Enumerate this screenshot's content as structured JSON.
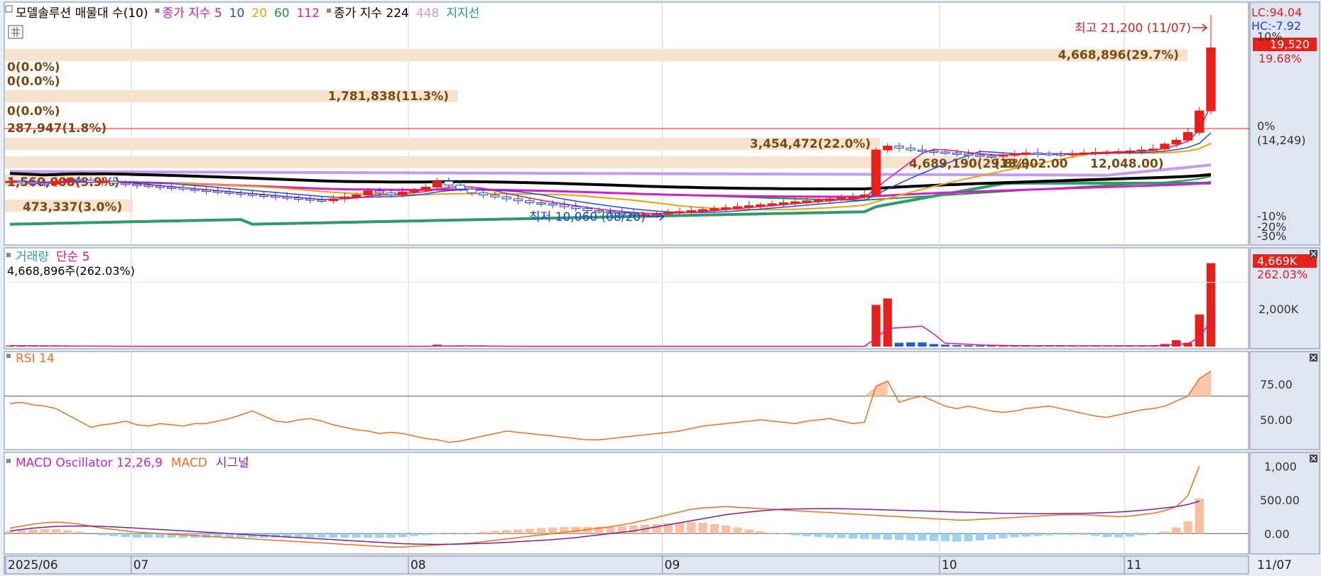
{
  "main": {
    "legend": [
      {
        "text": "모델솔루션 매물대 수(10)",
        "color": "#000000"
      },
      {
        "text": "종가 지수 5",
        "color": "#e0148c"
      },
      {
        "text": "10",
        "color": "#1f4fd6"
      },
      {
        "text": "20",
        "color": "#f0a010"
      },
      {
        "text": "60",
        "color": "#1f9a3a"
      },
      {
        "text": "112",
        "color": "#d020c8"
      },
      {
        "text": "종가 지수 224",
        "color": "#000000"
      },
      {
        "text": "448",
        "color": "#c39bf0"
      },
      {
        "text": "지지선",
        "color": "#1f9a6a"
      }
    ],
    "right_top": {
      "lc": "LC:94.04",
      "hc": "HC:-7.92"
    },
    "price_tag": "19,520",
    "price_change": "19.68%",
    "high_label": "최고 21,200 (11/07)",
    "low_label": "최저 10,060 (08/20)",
    "pct_axis": [
      "10%",
      "0%",
      "(14,249)",
      "-10%",
      "-20%",
      "-30%"
    ],
    "volume_profile": [
      {
        "label": "4,668,896(29.7%)"
      },
      {
        "label": "0(0.0%)"
      },
      {
        "label": "0(0.0%)"
      },
      {
        "label": "1,781,838(11.3%)"
      },
      {
        "label": "0(0.0%)"
      },
      {
        "label": "287,947(1.8%)"
      },
      {
        "label": "3,454,472(22.0%)"
      },
      {
        "label": "4,689,190(29.8%)"
      },
      {
        "label": "1,560,000(9.9%)"
      },
      {
        "label": "473,337(3.0%)"
      }
    ],
    "tail_labels": [
      "(13,902.00",
      "12,048.00)"
    ]
  },
  "volume": {
    "legend": [
      {
        "text": "거래량",
        "color": "#2aa0a8"
      },
      {
        "text": "단순 5",
        "color": "#e0148c"
      }
    ],
    "value_label": "4,668,896주(262.03%)",
    "tag": "4,669K",
    "tag_change": "262.03%",
    "axis": [
      "2,000K"
    ]
  },
  "rsi": {
    "legend": [
      {
        "text": "RSI 14",
        "color": "#f07020"
      }
    ],
    "axis": [
      "75.00",
      "50.00"
    ]
  },
  "macd": {
    "legend": [
      {
        "text": "MACD Oscillator 12,26,9",
        "color": "#d020c8"
      },
      {
        "text": "MACD",
        "color": "#f07020"
      },
      {
        "text": "시그널",
        "color": "#8020a0"
      }
    ],
    "axis": [
      "1,000",
      "500.00",
      "0.00"
    ]
  },
  "x_axis": [
    "2025/06",
    "07",
    "08",
    "09",
    "10",
    "11"
  ],
  "x_right": "11/07",
  "chart_data": [
    {
      "type": "candlestick",
      "title": "",
      "x": [
        "2025/06",
        "07",
        "08",
        "09",
        "10",
        "11"
      ],
      "series": [
        {
          "name": "close",
          "values": [
            12700,
            12650,
            12600,
            12550,
            12700,
            12800,
            12750,
            12650,
            12700,
            12600,
            12550,
            12500,
            12450,
            12400,
            12380,
            12300,
            12250,
            12200,
            12150,
            12100,
            12050,
            12000,
            11950,
            11900,
            11850,
            11800,
            11750,
            11700,
            11800,
            11900,
            12000,
            12200,
            12100,
            12000,
            12150,
            12250,
            12400,
            12700,
            12500,
            12300,
            12100,
            12000,
            11900,
            11800,
            11700,
            11600,
            11550,
            11500,
            11400,
            11300,
            11200,
            11150,
            11100,
            11050,
            11000,
            11000,
            11050,
            11100,
            11150,
            11200,
            11250,
            11300,
            11350,
            11400,
            11450,
            11500,
            11550,
            11600,
            11650,
            11700,
            11750,
            11800,
            11850,
            11900,
            12000,
            14300,
            14500,
            14400,
            14300,
            14250,
            14200,
            14150,
            14100,
            14050,
            14000,
            13980,
            14050,
            14100,
            14150,
            14120,
            14100,
            14080,
            14120,
            14150,
            14180,
            14200,
            14220,
            14250,
            14300,
            14350,
            14600,
            14800,
            15200,
            16300,
            19520
          ]
        },
        {
          "name": "5",
          "values": [
            12700,
            12690,
            12670,
            12640,
            12660,
            12700,
            12720,
            12710,
            12700,
            12680,
            12640,
            12590,
            12540,
            12480,
            12430,
            12380,
            12320,
            12270,
            12220,
            12170,
            12120,
            12070,
            12020,
            11970,
            11920,
            11870,
            11820,
            11770,
            11780,
            11810,
            11850,
            11930,
            11990,
            12030,
            12070,
            12110,
            12170,
            12290,
            12390,
            12430,
            12410,
            12340,
            12220,
            12080,
            11960,
            11840,
            11730,
            11630,
            11540,
            11450,
            11360,
            11280,
            11210,
            11150,
            11100,
            11060,
            11050,
            11060,
            11080,
            11110,
            11150,
            11200,
            11250,
            11300,
            11350,
            11400,
            11450,
            11500,
            11550,
            11600,
            11650,
            11700,
            11750,
            11800,
            11860,
            12330,
            12810,
            13250,
            13700,
            14120,
            14330,
            14310,
            14240,
            14170,
            14110,
            14060,
            14040,
            14050,
            14080,
            14100,
            14110,
            14110,
            14110,
            14120,
            14150,
            14180,
            14200,
            14220,
            14250,
            14280,
            14380,
            14530,
            14750,
            15330,
            16600
          ]
        }
      ],
      "high": 21200,
      "low": 10060,
      "ylim": [
        9800,
        21500
      ]
    },
    {
      "type": "bar",
      "title": "",
      "series": [
        {
          "name": "거래량",
          "values": [
            30,
            25,
            20,
            20,
            18,
            15,
            12,
            10,
            10,
            8,
            8,
            8,
            8,
            8,
            8,
            8,
            8,
            8,
            8,
            8,
            8,
            8,
            8,
            8,
            8,
            8,
            8,
            8,
            8,
            8,
            8,
            8,
            8,
            8,
            8,
            8,
            8,
            60,
            20,
            15,
            10,
            10,
            8,
            8,
            8,
            8,
            8,
            8,
            8,
            8,
            8,
            8,
            8,
            8,
            8,
            8,
            8,
            8,
            8,
            8,
            8,
            8,
            8,
            8,
            8,
            8,
            8,
            8,
            8,
            8,
            8,
            8,
            8,
            8,
            8,
            1300,
            1500,
            120,
            130,
            130,
            80,
            60,
            50,
            40,
            30,
            30,
            30,
            30,
            25,
            25,
            25,
            25,
            25,
            25,
            25,
            25,
            25,
            25,
            25,
            25,
            80,
            200,
            120,
            1000,
            2600
          ]
        }
      ],
      "ylim": [
        0,
        2700
      ]
    },
    {
      "type": "line",
      "title": "",
      "series": [
        {
          "name": "RSI 14",
          "values": [
            64,
            65,
            63,
            62,
            60,
            55,
            50,
            45,
            47,
            48,
            50,
            47,
            46,
            48,
            47,
            46,
            48,
            48,
            50,
            52,
            55,
            58,
            54,
            50,
            49,
            51,
            52,
            50,
            47,
            45,
            43,
            42,
            40,
            41,
            40,
            38,
            36,
            35,
            33,
            34,
            36,
            38,
            40,
            42,
            41,
            40,
            39,
            38,
            37,
            36,
            35,
            35,
            36,
            37,
            38,
            39,
            40,
            41,
            42,
            44,
            46,
            47,
            48,
            49,
            50,
            51,
            50,
            49,
            48,
            50,
            51,
            52,
            50,
            48,
            49,
            78,
            82,
            65,
            68,
            70,
            66,
            62,
            60,
            62,
            60,
            58,
            57,
            58,
            60,
            61,
            62,
            60,
            58,
            56,
            54,
            53,
            55,
            57,
            59,
            60,
            62,
            66,
            70,
            84,
            90
          ]
        }
      ],
      "ylim": [
        30,
        100
      ]
    },
    {
      "type": "line",
      "title": "",
      "series": [
        {
          "name": "MACD",
          "values": [
            80,
            110,
            140,
            160,
            170,
            160,
            140,
            110,
            80,
            60,
            40,
            20,
            10,
            0,
            -10,
            -20,
            -30,
            -40,
            -50,
            -60,
            -70,
            -80,
            -90,
            -100,
            -110,
            -120,
            -130,
            -140,
            -150,
            -160,
            -170,
            -180,
            -190,
            -200,
            -200,
            -190,
            -180,
            -170,
            -160,
            -150,
            -140,
            -120,
            -100,
            -80,
            -60,
            -40,
            -20,
            0,
            20,
            40,
            60,
            80,
            100,
            130,
            160,
            200,
            240,
            280,
            320,
            360,
            380,
            390,
            400,
            390,
            380,
            370,
            360,
            350,
            340,
            330,
            320,
            310,
            300,
            290,
            280,
            270,
            260,
            250,
            240,
            230,
            220,
            210,
            200,
            200,
            210,
            220,
            230,
            240,
            250,
            260,
            270,
            280,
            280,
            280,
            270,
            260,
            250,
            260,
            280,
            300,
            340,
            400,
            560,
            1000
          ]
        },
        {
          "name": "시그널",
          "values": [
            40,
            60,
            80,
            95,
            105,
            110,
            112,
            110,
            105,
            98,
            90,
            80,
            70,
            60,
            50,
            40,
            30,
            20,
            10,
            0,
            -10,
            -20,
            -30,
            -40,
            -50,
            -60,
            -70,
            -80,
            -90,
            -100,
            -110,
            -120,
            -130,
            -140,
            -150,
            -155,
            -158,
            -160,
            -158,
            -155,
            -150,
            -145,
            -140,
            -130,
            -120,
            -110,
            -100,
            -90,
            -75,
            -60,
            -40,
            -20,
            0,
            20,
            40,
            70,
            100,
            130,
            160,
            190,
            220,
            250,
            280,
            300,
            320,
            335,
            350,
            360,
            365,
            368,
            370,
            370,
            368,
            365,
            360,
            355,
            350,
            345,
            340,
            335,
            330,
            325,
            320,
            315,
            310,
            305,
            300,
            298,
            296,
            295,
            295,
            296,
            298,
            300,
            305,
            310,
            320,
            330,
            345,
            360,
            380,
            400,
            430,
            480
          ]
        },
        {
          "name": "MACD Oscillator 12,26,9",
          "values": [
            40,
            50,
            60,
            65,
            65,
            50,
            28,
            0,
            -25,
            -38,
            -50,
            -60,
            -60,
            -60,
            -60,
            -60,
            -60,
            -60,
            -60,
            -60,
            -60,
            -60,
            -60,
            -60,
            -60,
            -60,
            -60,
            -60,
            -60,
            -60,
            -60,
            -60,
            -60,
            -60,
            -50,
            -35,
            -22,
            -10,
            -2,
            5,
            10,
            25,
            40,
            50,
            60,
            70,
            80,
            90,
            95,
            100,
            100,
            100,
            100,
            110,
            120,
            130,
            140,
            150,
            160,
            170,
            160,
            140,
            120,
            90,
            60,
            35,
            10,
            -10,
            -25,
            -38,
            -50,
            -60,
            -68,
            -75,
            -80,
            -85,
            -90,
            -95,
            -100,
            -105,
            -110,
            -115,
            -120,
            -115,
            -100,
            -85,
            -70,
            -55,
            -45,
            -35,
            -25,
            -16,
            -18,
            -20,
            -35,
            -50,
            -55,
            -45,
            -25,
            -10,
            30,
            90,
            180,
            520
          ]
        }
      ],
      "ylim": [
        -250,
        1150
      ]
    }
  ]
}
